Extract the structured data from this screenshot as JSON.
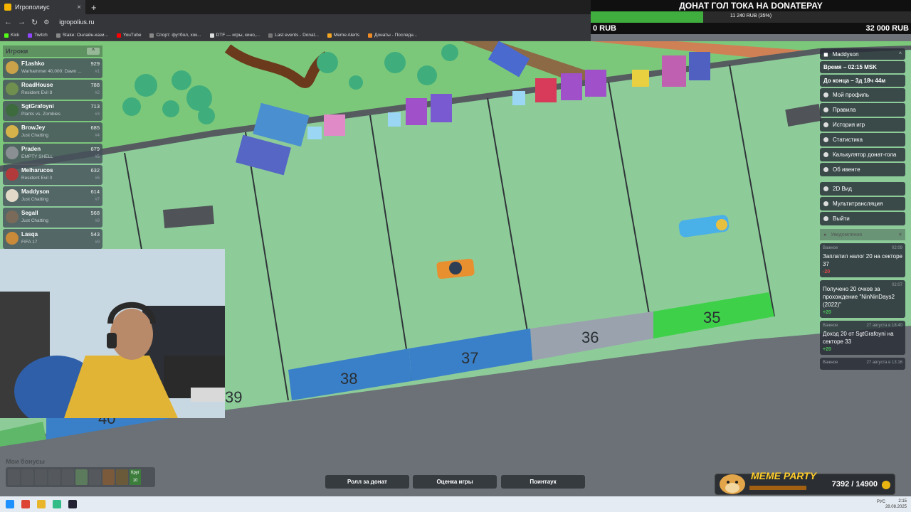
{
  "browser": {
    "tab_title": "Игрополиус",
    "url": "igropolius.ru",
    "bookmarks": [
      "Kick",
      "Twitch",
      "Stake: Онлайн-кази...",
      "YouTube",
      "Спорт: футбол, хок...",
      "DTF — игры, кино,...",
      "Last events - Donat...",
      "Meme Alerts",
      "Донаты - Последн..."
    ]
  },
  "goal": {
    "title": "ДОНАТ ГОЛ ТОКА НА DONATEPAY",
    "progress_text": "11 240 RUB (35%)",
    "progress_fraction": 0.35,
    "min": "0 RUB",
    "max": "32 000 RUB",
    "fill_color": "#3fae3f"
  },
  "players": {
    "header": "Игроки",
    "list": [
      {
        "name": "F1ashko",
        "game": "Warhammer 40,000: Dawn ...",
        "score": "929",
        "rank": "#1",
        "color": "#c9a24a"
      },
      {
        "name": "RoadHouse",
        "game": "Resident Evil 8",
        "score": "788",
        "rank": "#2",
        "color": "#6f8f4e"
      },
      {
        "name": "SgtGrafoyni",
        "game": "Plants vs. Zombies",
        "score": "713",
        "rank": "#3",
        "color": "#3d6b3d"
      },
      {
        "name": "BrowJey",
        "game": "Just Chatting",
        "score": "685",
        "rank": "#4",
        "color": "#d6b24b"
      },
      {
        "name": "Praden",
        "game": "EMPTY SHELL",
        "score": "679",
        "rank": "#5",
        "color": "#8a8f94"
      },
      {
        "name": "Melharucos",
        "game": "Resident Evil 0",
        "score": "632",
        "rank": "#6",
        "color": "#b33a3a"
      },
      {
        "name": "Maddyson",
        "game": "Just Chatting",
        "score": "614",
        "rank": "#7",
        "color": "#e2d9c8"
      },
      {
        "name": "Segall",
        "game": "Just Chatting",
        "score": "568",
        "rank": "#8",
        "color": "#7a6a5a"
      },
      {
        "name": "Lasqa",
        "game": "FIFA 17",
        "score": "543",
        "rank": "#9",
        "color": "#c98a3a"
      }
    ]
  },
  "menu": {
    "user": "Maddyson",
    "time": "Время – 02:15 MSK",
    "remaining": "До конца – 3д 18ч 44м",
    "items": [
      "Мой профиль",
      "Правила",
      "История игр",
      "Статистика",
      "Калькулятор донат-гола",
      "Об ивенте"
    ],
    "items2": [
      "2D Вид",
      "Мультитрансляция",
      "Выйти"
    ]
  },
  "notifications": {
    "header": "Уведомления",
    "list": [
      {
        "tag": "Важное",
        "time": "02:09",
        "text": "Заплатил налог 20 на секторе 37",
        "delta": "-20",
        "color": "#e04848"
      },
      {
        "tag": "",
        "time": "02:07",
        "text": "Получено 20 очков за прохождение \"NinNinDays2 (2022)\"",
        "delta": "+20",
        "color": "#4cc25a"
      },
      {
        "tag": "Важное",
        "time": "27 августа в 18:40",
        "text": "Доход 20 от SgtGrafoyni на секторе 33",
        "delta": "+20",
        "color": "#4cc25a"
      },
      {
        "tag": "Важное",
        "time": "27 августа в 13:16",
        "text": "",
        "delta": "",
        "color": "#4cc25a"
      }
    ]
  },
  "board": {
    "tiles": [
      {
        "number": "35",
        "color": "#3fd04a"
      },
      {
        "number": "36",
        "color": "#9aa3ad"
      },
      {
        "number": "37",
        "color": "#3a80c8"
      },
      {
        "number": "38",
        "color": "#3a80c8"
      },
      {
        "number": "39",
        "color": ""
      },
      {
        "number": "40",
        "color": "#3a80c8"
      }
    ]
  },
  "bonuses": {
    "label": "Мои бонусы",
    "count_label": "Круг",
    "count": "10"
  },
  "buttons": {
    "roll": "Ролл за донат",
    "rate": "Оценка игры",
    "pointauc": "Поинтаук"
  },
  "meme_party": {
    "name": "MEME PARTY",
    "count": "7392 / 14900",
    "progress_fraction": 0.496
  },
  "taskbar": {
    "lang": "РУС",
    "time": "2:15",
    "date": "28.08.2025"
  }
}
